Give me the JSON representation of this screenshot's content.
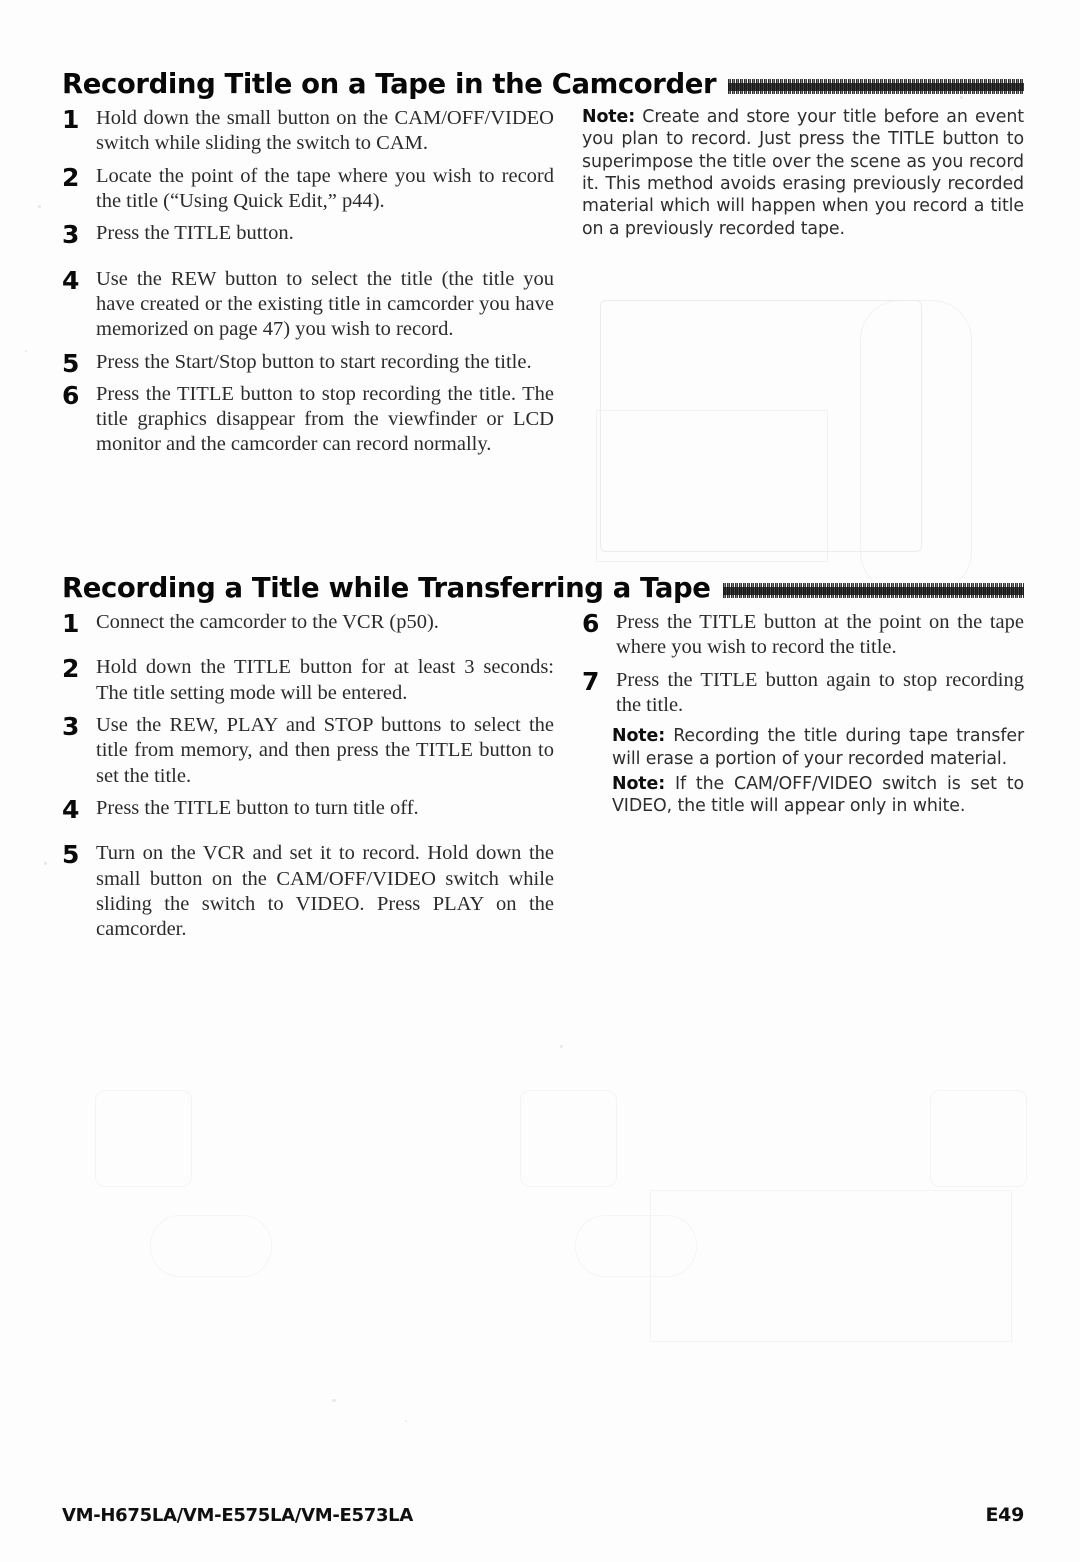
{
  "page": {
    "background_color": "#fdfdfd",
    "text_color": "#1a1a1a"
  },
  "sections": [
    {
      "heading": "Recording Title on a Tape in the Camcorder",
      "left_column": {
        "steps": [
          {
            "num": "1",
            "text": "Hold down the small button on the CAM/OFF/VIDEO switch while sliding the switch to CAM."
          },
          {
            "num": "2",
            "text": "Locate the point of the tape where you wish to record the title (“Using Quick Edit,” p44)."
          },
          {
            "num": "3",
            "text": "Press the TITLE button."
          },
          {
            "num": "4",
            "text": "Use the REW button to select the title (the title you have created or the existing title in camcorder you have memorized on page 47) you wish to record."
          },
          {
            "num": "5",
            "text": "Press the Start/Stop button to start recording the title."
          },
          {
            "num": "6",
            "text": "Press the TITLE button to stop recording the title.  The title graphics disappear from the viewfinder or LCD monitor and the camcorder can record normally."
          }
        ]
      },
      "right_column": {
        "notes": [
          {
            "label": "Note:",
            "text": "Create and store your title before an event you plan to record.  Just press the TITLE button to superimpose the title over the scene as you record it.  This method avoids erasing previously recorded material which will happen when you record a title on a previously recorded tape."
          }
        ],
        "illustration_caption": "hand-holding-camcorder-illustration"
      }
    },
    {
      "heading": "Recording a Title while Transferring a Tape",
      "left_column": {
        "steps": [
          {
            "num": "1",
            "text": "Connect the camcorder to the VCR (p50)."
          },
          {
            "num": "2",
            "text": "Hold down the TITLE button for at least 3 seconds: The title setting mode will be entered."
          },
          {
            "num": "3",
            "text": "Use the REW, PLAY and STOP buttons to select the title from memory, and then press the TITLE button to set the title."
          },
          {
            "num": "4",
            "text": "Press the TITLE button to turn title off."
          },
          {
            "num": "5",
            "text": "Turn on the VCR and set it to record.  Hold down the small button on the CAM/OFF/VIDEO switch while sliding the switch to VIDEO. Press PLAY on the camcorder."
          }
        ]
      },
      "right_column": {
        "steps": [
          {
            "num": "6",
            "text": "Press the TITLE button at the point on the tape where you wish to record the title."
          },
          {
            "num": "7",
            "text": "Press the TITLE button again to stop recording the title."
          }
        ],
        "notes": [
          {
            "label": "Note:",
            "text": "Recording the title during tape transfer will erase a portion of your recorded material."
          },
          {
            "label": "Note:",
            "text": "If the CAM/OFF/VIDEO switch is set to VIDEO, the title will appear only in white."
          }
        ]
      }
    }
  ],
  "footer": {
    "models": "VM-H675LA/VM-E575LA/VM-E573LA",
    "page_number": "E49"
  }
}
